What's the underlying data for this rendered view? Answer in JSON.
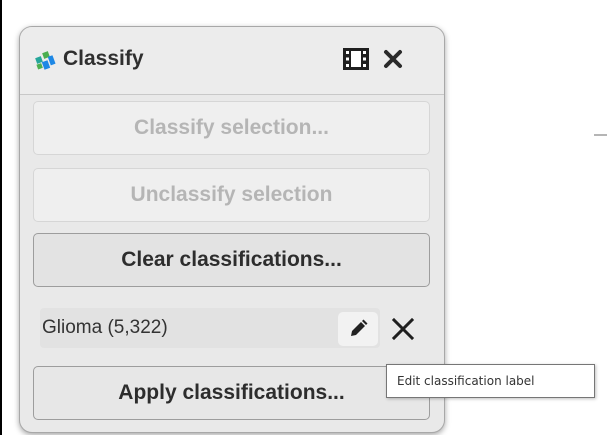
{
  "panel": {
    "title": "Classify",
    "logo_icon": "classify-logo-icon",
    "undock_icon": "undock-panel-icon",
    "close_icon": "close-icon"
  },
  "buttons": {
    "classify_selection": {
      "label": "Classify selection...",
      "enabled": false
    },
    "unclassify_selection": {
      "label": "Unclassify selection",
      "enabled": false
    },
    "clear_classifications": {
      "label": "Clear classifications...",
      "enabled": true
    },
    "apply_classifications": {
      "label": "Apply classifications...",
      "enabled": true
    }
  },
  "classifications": [
    {
      "label": "Glioma (5,322)",
      "edit_icon": "pencil-icon",
      "remove_icon": "x-icon"
    }
  ],
  "tooltip": {
    "text": "Edit classification label"
  },
  "colors": {
    "logo_green": "#4caf50",
    "logo_blue": "#1e88e5",
    "logo_teal": "#26a69a"
  }
}
